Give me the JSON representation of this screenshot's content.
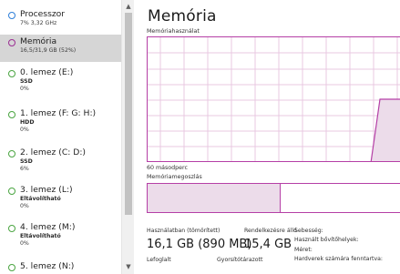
{
  "colors": {
    "cpu": "#2e7fd9",
    "memory": "#9b2f93",
    "disk": "#4aa541",
    "selected_bg": "#d6d6d6",
    "graph_border": "#b53fa6",
    "graph_grid": "#e8c8e2",
    "graph_fill": "#ecdcea"
  },
  "sidebar": {
    "items": [
      {
        "name": "Processzor",
        "line1": "7% 3,32 GHz",
        "line2": "",
        "icon": "cpu-ring-icon",
        "color": "#2e7fd9"
      },
      {
        "name": "Memória",
        "line1": "16,5/31,9 GB (52%)",
        "line2": "",
        "icon": "memory-ring-icon",
        "color": "#9b2f93"
      },
      {
        "name": "0. lemez (E:)",
        "line1": "SSD",
        "line2": "0%",
        "icon": "disk-ring-icon",
        "color": "#4aa541"
      },
      {
        "name": "1. lemez (F: G: H:)",
        "line1": "HDD",
        "line2": "0%",
        "icon": "disk-ring-icon",
        "color": "#4aa541"
      },
      {
        "name": "2. lemez (C: D:)",
        "line1": "SSD",
        "line2": "6%",
        "icon": "disk-ring-icon",
        "color": "#4aa541"
      },
      {
        "name": "3. lemez (L:)",
        "line1": "Eltávolítható",
        "line2": "0%",
        "icon": "disk-ring-icon",
        "color": "#4aa541"
      },
      {
        "name": "4. lemez (M:)",
        "line1": "Eltávolítható",
        "line2": "0%",
        "icon": "disk-ring-icon",
        "color": "#4aa541"
      },
      {
        "name": "5. lemez (N:)",
        "line1": "",
        "line2": "",
        "icon": "disk-ring-icon",
        "color": "#4aa541"
      }
    ]
  },
  "main": {
    "title": "Memória",
    "usage_label": "Memóriahasználat",
    "time_label": "60 másodperc",
    "composition_label": "Memóriamegoszlás",
    "composition_used_fraction": 0.52,
    "stats": {
      "in_use_label": "Használatban (tömörített)",
      "in_use_value": "16,1 GB (890 MB)",
      "available_label": "Rendelkezésre álló",
      "available_value": "15,4 GB",
      "committed_label": "Lefoglalt",
      "cached_label": "Gyorsítótárazott"
    },
    "meta": {
      "speed_label": "Sebesség:",
      "slots_label": "Használt bővítőhelyek:",
      "form_label": "Méret:",
      "reserved_label": "Hardverek számára fenntartva:"
    }
  }
}
